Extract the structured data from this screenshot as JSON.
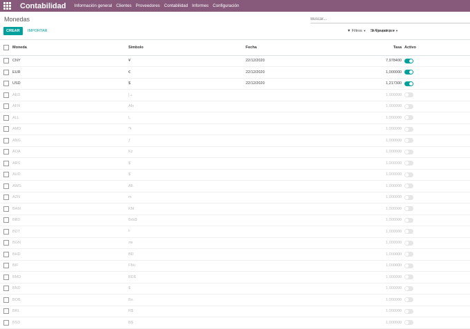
{
  "app": {
    "title": "Contabilidad"
  },
  "menu": [
    "Información general",
    "Clientes",
    "Proveedores",
    "Contabilidad",
    "Informes",
    "Configuración"
  ],
  "page": {
    "title": "Monedas"
  },
  "search": {
    "placeholder": "Buscar..."
  },
  "buttons": {
    "create": "CREAR",
    "import": "IMPORTAR"
  },
  "filters": {
    "filtros": "Filtros",
    "agrupar": "Agrupar por",
    "favoritos": "Favoritos"
  },
  "columns": {
    "moneda": "Moneda",
    "simbolo": "Símbolo",
    "fecha": "Fecha",
    "tasa": "Tasa",
    "activo": "Activo"
  },
  "rows": [
    {
      "moneda": "CNY",
      "simbolo": "¥",
      "fecha": "22/12/2020",
      "tasa": "7,978400",
      "active": true
    },
    {
      "moneda": "EUR",
      "simbolo": "€",
      "fecha": "22/12/2020",
      "tasa": "1,000000",
      "active": true
    },
    {
      "moneda": "USD",
      "simbolo": "$",
      "fecha": "22/12/2020",
      "tasa": "1,217300",
      "active": true
    },
    {
      "moneda": "AED",
      "simbolo": "د.إ",
      "fecha": "",
      "tasa": "1,000000",
      "active": false
    },
    {
      "moneda": "AFN",
      "simbolo": "Afs",
      "fecha": "",
      "tasa": "1,000000",
      "active": false
    },
    {
      "moneda": "ALL",
      "simbolo": "L",
      "fecha": "",
      "tasa": "1,000000",
      "active": false
    },
    {
      "moneda": "AMD",
      "simbolo": "֏",
      "fecha": "",
      "tasa": "1,000000",
      "active": false
    },
    {
      "moneda": "ANG",
      "simbolo": "ƒ",
      "fecha": "",
      "tasa": "1,000000",
      "active": false
    },
    {
      "moneda": "AOA",
      "simbolo": "Kz",
      "fecha": "",
      "tasa": "1,000000",
      "active": false
    },
    {
      "moneda": "ARS",
      "simbolo": "$",
      "fecha": "",
      "tasa": "1,000000",
      "active": false
    },
    {
      "moneda": "AUD",
      "simbolo": "$",
      "fecha": "",
      "tasa": "1,000000",
      "active": false
    },
    {
      "moneda": "AWG",
      "simbolo": "Afl.",
      "fecha": "",
      "tasa": "1,000000",
      "active": false
    },
    {
      "moneda": "AZN",
      "simbolo": "m",
      "fecha": "",
      "tasa": "1,000000",
      "active": false
    },
    {
      "moneda": "BAM",
      "simbolo": "KM",
      "fecha": "",
      "tasa": "1,000000",
      "active": false
    },
    {
      "moneda": "BBD",
      "simbolo": "Bds$",
      "fecha": "",
      "tasa": "1,000000",
      "active": false
    },
    {
      "moneda": "BDT",
      "simbolo": "৳",
      "fecha": "",
      "tasa": "1,000000",
      "active": false
    },
    {
      "moneda": "BGN",
      "simbolo": "лв",
      "fecha": "",
      "tasa": "1,000000",
      "active": false
    },
    {
      "moneda": "BHD",
      "simbolo": "BD",
      "fecha": "",
      "tasa": "1,000000",
      "active": false
    },
    {
      "moneda": "BIF",
      "simbolo": "FBu",
      "fecha": "",
      "tasa": "1,000000",
      "active": false
    },
    {
      "moneda": "BMD",
      "simbolo": "BD$",
      "fecha": "",
      "tasa": "1,000000",
      "active": false
    },
    {
      "moneda": "BND",
      "simbolo": "$",
      "fecha": "",
      "tasa": "1,000000",
      "active": false
    },
    {
      "moneda": "BOB",
      "simbolo": "Bs.",
      "fecha": "",
      "tasa": "1,000000",
      "active": false
    },
    {
      "moneda": "BRL",
      "simbolo": "R$",
      "fecha": "",
      "tasa": "1,000000",
      "active": false
    },
    {
      "moneda": "BSD",
      "simbolo": "B$",
      "fecha": "",
      "tasa": "1,000000",
      "active": false
    }
  ],
  "colors": {
    "topbar": "#875a7b",
    "accent": "#00a09d"
  }
}
